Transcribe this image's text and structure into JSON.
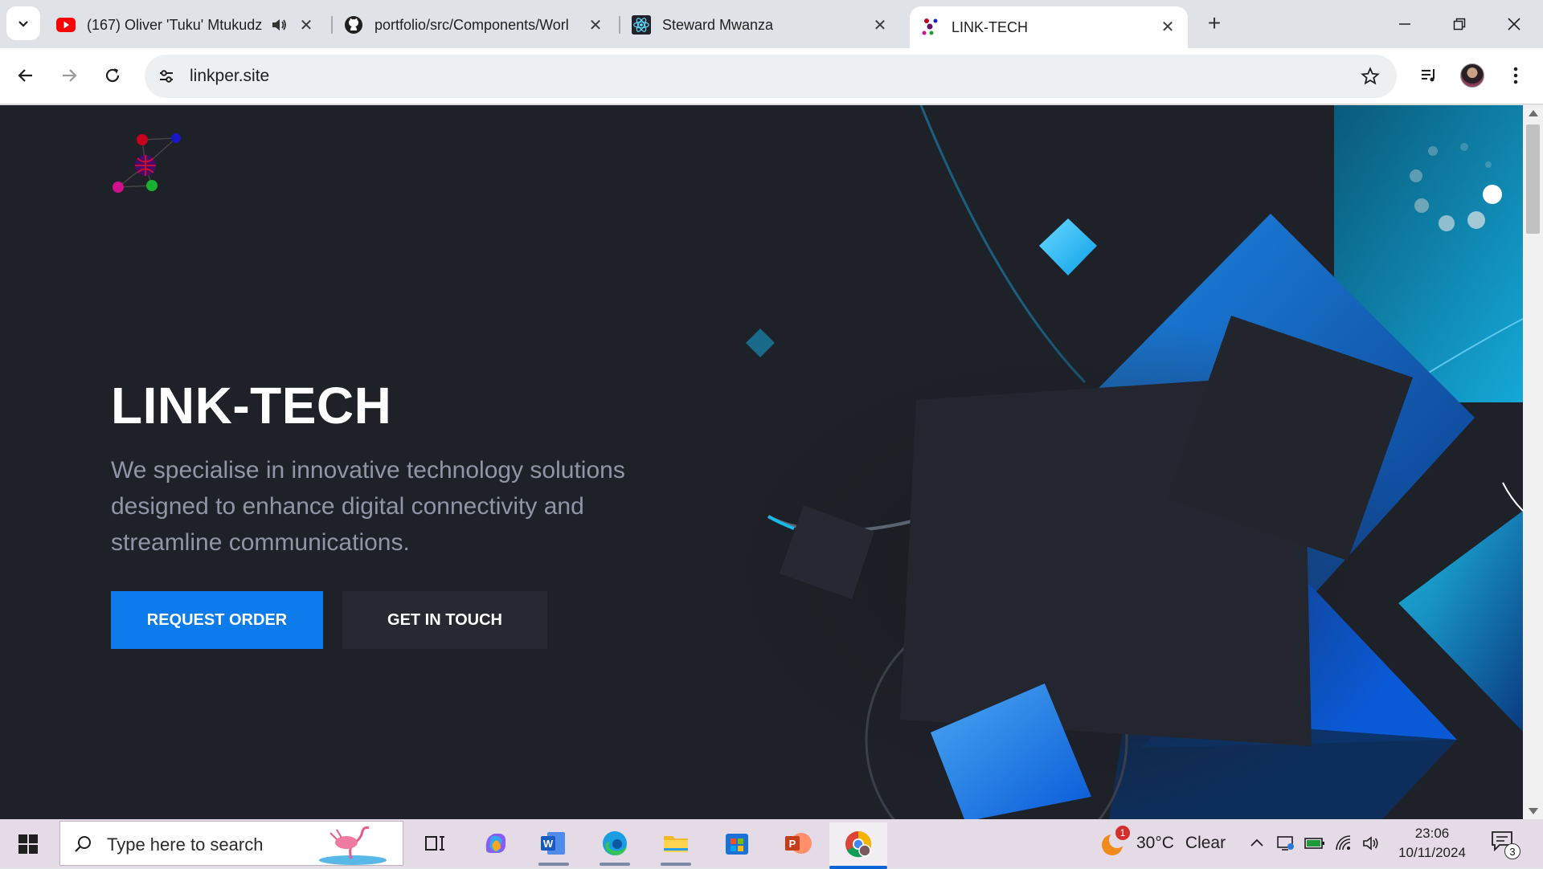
{
  "browser": {
    "tabs": [
      {
        "title": "(167) Oliver 'Tuku' Mtukudz",
        "favicon": "youtube-icon",
        "audio": true
      },
      {
        "title": "portfolio/src/Components/Worl",
        "favicon": "github-icon"
      },
      {
        "title": "Steward Mwanza",
        "favicon": "react-icon"
      },
      {
        "title": "LINK-TECH",
        "favicon": "linktech-logo-icon",
        "active": true
      }
    ],
    "url": "linkper.site",
    "colors": {
      "accent": "#0c7cec",
      "tab_bar": "#dfe3e8"
    }
  },
  "page": {
    "title": "LINK-TECH",
    "subtitle": "We specialise in innovative technology solutions designed to enhance digital connectivity and streamline communications.",
    "buttons": {
      "primary": "REQUEST ORDER",
      "secondary": "GET IN TOUCH"
    },
    "colors": {
      "background": "#1f2128",
      "primary_button": "#0c7cec",
      "secondary_button": "#262932",
      "subtitle": "#9096a5"
    }
  },
  "taskbar": {
    "search_placeholder": "Type here to search",
    "apps": [
      "task-view-icon",
      "copilot-icon",
      "word-icon",
      "edge-icon",
      "file-explorer-icon",
      "microsoft-store-icon",
      "powerpoint-icon",
      "chrome-icon"
    ],
    "weather": {
      "temp": "30°C",
      "condition": "Clear",
      "badge": "1"
    },
    "time": "23:06",
    "date": "10/11/2024",
    "notification_count": "3"
  }
}
